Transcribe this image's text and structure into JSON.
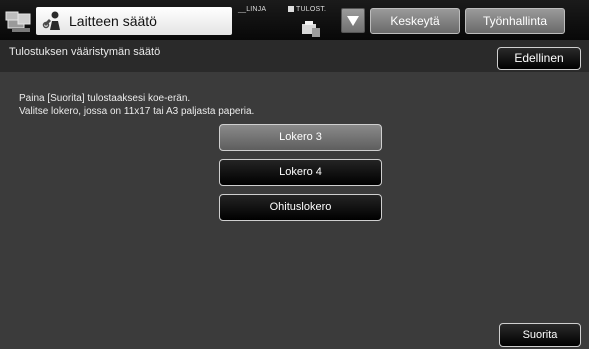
{
  "header": {
    "title": "Laitteen säätö",
    "status_linja": "LINJA",
    "status_tulost": "TULOST.",
    "keskeyta_label": "Keskeytä",
    "tyonhallinta_label": "Työnhallinta"
  },
  "subheader": {
    "title": "Tulostuksen vääristymän säätö",
    "back_label": "Edellinen"
  },
  "main": {
    "instruction_line1": "Paina [Suorita] tulostaaksesi koe-erän.",
    "instruction_line2": "Valitse lokero, jossa on 11x17 tai A3 paljasta paperia.",
    "trays": [
      {
        "label": "Lokero 3",
        "selected": true
      },
      {
        "label": "Lokero 4",
        "selected": false
      },
      {
        "label": "Ohituslokero",
        "selected": false
      }
    ],
    "execute_label": "Suorita"
  },
  "icons": {
    "app": "device-settings-icon",
    "title": "wrench-user-icon",
    "printer": "printer-status-icon",
    "dropdown": "triangle-down-icon"
  }
}
